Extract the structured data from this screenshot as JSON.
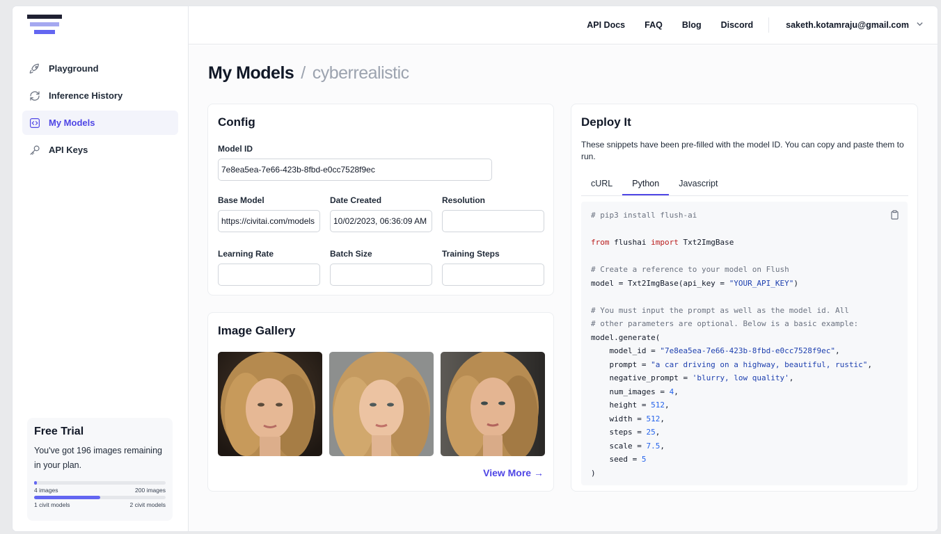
{
  "nav": {
    "items": [
      {
        "label": "Playground",
        "icon": "rocket-icon"
      },
      {
        "label": "Inference History",
        "icon": "refresh-icon"
      },
      {
        "label": "My Models",
        "icon": "code-box-icon",
        "active": true
      },
      {
        "label": "API Keys",
        "icon": "key-icon"
      }
    ]
  },
  "trial": {
    "title": "Free Trial",
    "text": "You've got 196 images remaining in your plan.",
    "images_left": "4 images",
    "images_right": "200 images",
    "images_fraction": 0.02,
    "models_left": "1 civit models",
    "models_right": "2 civit models",
    "models_fraction": 0.5
  },
  "topnav": {
    "links": [
      "API Docs",
      "FAQ",
      "Blog",
      "Discord"
    ],
    "user": "saketh.kotamraju@gmail.com"
  },
  "page": {
    "title": "My Models",
    "subtitle": "cyberrealistic"
  },
  "config": {
    "title": "Config",
    "model_id_label": "Model ID",
    "model_id_value": "7e8ea5ea-7e66-423b-8fbd-e0cc7528f9ec",
    "base_model_label": "Base Model",
    "base_model_value": "https://civitai.com/models",
    "date_created_label": "Date Created",
    "date_created_value": "10/02/2023, 06:36:09 AM",
    "resolution_label": "Resolution",
    "resolution_value": "",
    "learning_rate_label": "Learning Rate",
    "learning_rate_value": "",
    "batch_size_label": "Batch Size",
    "batch_size_value": "",
    "training_steps_label": "Training Steps",
    "training_steps_value": ""
  },
  "gallery": {
    "title": "Image Gallery",
    "view_more": "View More →"
  },
  "deploy": {
    "title": "Deploy It",
    "description": "These snippets have been pre-filled with the model ID. You can copy and paste them to run.",
    "tabs": [
      "cURL",
      "Python",
      "Javascript"
    ],
    "active_tab": "Python",
    "code": {
      "l1": "# pip3 install flush-ai",
      "l3a": "from",
      "l3b": " flushai ",
      "l3c": "import",
      "l3d": " Txt2ImgBase",
      "l5": "# Create a reference to your model on Flush",
      "l6a": "model = Txt2ImgBase(api_key = ",
      "l6b": "\"YOUR_API_KEY\"",
      "l6c": ")",
      "l8": "# You must input the prompt as well as the model id. All",
      "l9": "# other parameters are optional. Below is a basic example:",
      "l10": "model.generate(",
      "l11a": "    model_id = ",
      "l11b": "\"7e8ea5ea-7e66-423b-8fbd-e0cc7528f9ec\"",
      "l11c": ",",
      "l12a": "    prompt = ",
      "l12b": "\"a car driving on a highway, beautiful, rustic\"",
      "l12c": ",",
      "l13a": "    negative_prompt = ",
      "l13b": "'blurry, low quality'",
      "l13c": ",",
      "l14a": "    num_images = ",
      "l14b": "4",
      "l15a": "    height = ",
      "l15b": "512",
      "l16a": "    width = ",
      "l16b": "512",
      "l17a": "    steps = ",
      "l17b": "25",
      "l18a": "    scale = ",
      "l18b": "7.5",
      "l19a": "    seed = ",
      "l19b": "5",
      "l20": ")",
      "comma": ","
    }
  },
  "colors": {
    "accent": "#4f46e5",
    "logo_dark": "#1f2032",
    "logo_light": "#a5a8f0",
    "logo_mid": "#6366f1"
  }
}
